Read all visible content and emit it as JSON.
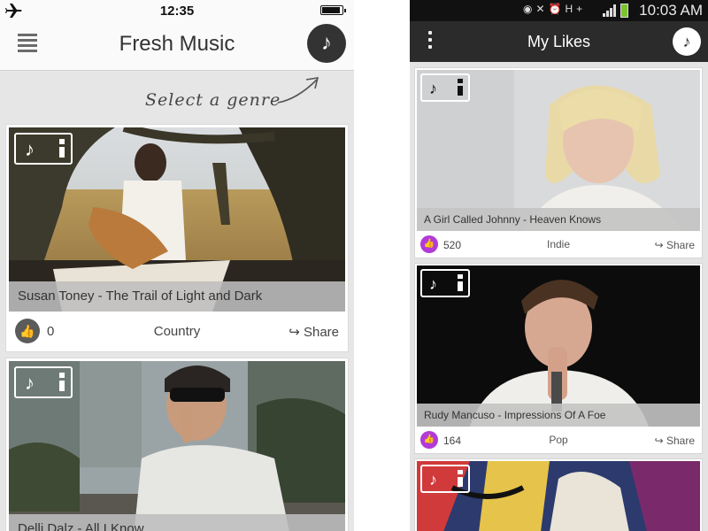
{
  "left_app": {
    "status_bar": {
      "time": "12:35"
    },
    "header": {
      "title": "Fresh Music",
      "music_button_glyph": "♪"
    },
    "genre_prompt": "Select a genre",
    "cards": [
      {
        "caption": "Susan Toney - The Trail of Light and Dark",
        "likes": "0",
        "genre": "Country",
        "share_label": "Share"
      },
      {
        "caption": "Delli Dalz - All I Know"
      }
    ]
  },
  "right_app": {
    "status_bar": {
      "time": "10:03 AM",
      "network": "H+"
    },
    "header": {
      "title": "My Likes",
      "music_button_glyph": "♪"
    },
    "cards": [
      {
        "caption": "A Girl Called Johnny - Heaven Knows",
        "likes": "520",
        "genre": "Indie",
        "share_label": "Share"
      },
      {
        "caption": "Rudy Mancuso - Impressions Of A Foe",
        "likes": "164",
        "genre": "Pop",
        "share_label": "Share"
      }
    ]
  },
  "icons": {
    "thumbs_up": "👍",
    "share_arrow": "↪",
    "note": "♪"
  },
  "colors": {
    "android_like_purple": "#b13ad8",
    "ios_like_gray": "#5b5b5b",
    "android_bar": "#2b2b2b",
    "android_battery": "#7bc52c"
  }
}
